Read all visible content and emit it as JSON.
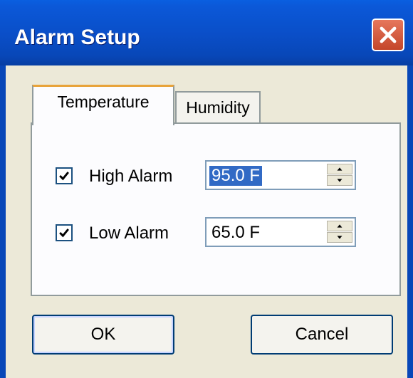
{
  "window": {
    "title": "Alarm Setup",
    "close_icon": "close-icon",
    "colors": {
      "titlebar": "#0a4fc9",
      "face": "#ece9d8",
      "close": "#c4462a",
      "selection": "#316ac5"
    }
  },
  "tabs": [
    {
      "label": "Temperature",
      "selected": true
    },
    {
      "label": "Humidity",
      "selected": false
    }
  ],
  "alarms": {
    "high": {
      "label": "High Alarm",
      "checked": true,
      "value": "95.0 F",
      "value_selected": true
    },
    "low": {
      "label": "Low Alarm",
      "checked": true,
      "value": "65.0 F",
      "value_selected": false
    }
  },
  "buttons": {
    "ok_label": "OK",
    "cancel_label": "Cancel"
  },
  "icons": {
    "checkbox": "check-icon",
    "spin_up": "spin-up-icon",
    "spin_down": "spin-down-icon"
  }
}
